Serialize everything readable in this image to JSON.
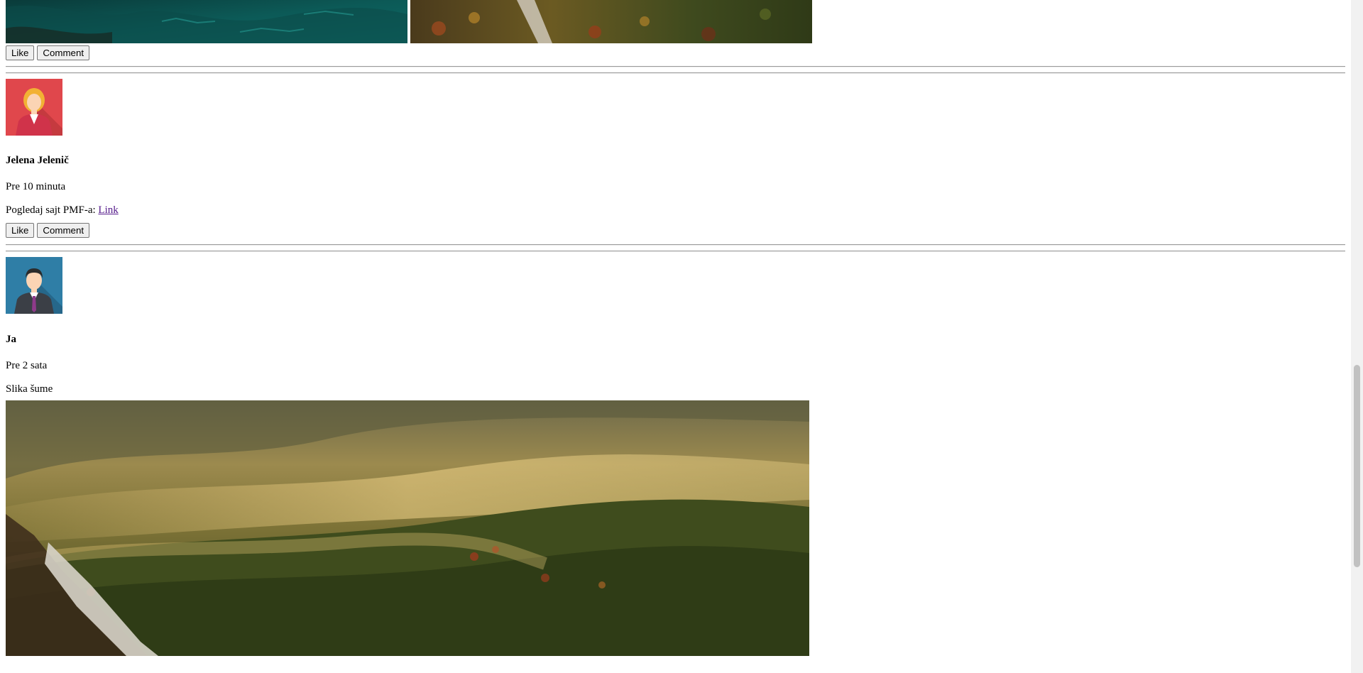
{
  "buttons": {
    "like": "Like",
    "comment": "Comment"
  },
  "posts": [
    {
      "author": "Jelena Jelenič",
      "time": "Pre 10 minuta",
      "text": "Pogledaj sajt PMF-a:",
      "link_text": "Link",
      "avatar_icon": "female-avatar-icon",
      "avatar_color": "#e0474c"
    },
    {
      "author": "Ja",
      "time": "Pre 2 sata",
      "text": "Slika šume",
      "avatar_icon": "male-avatar-icon",
      "avatar_color": "#2f7ea6"
    }
  ],
  "colors": {
    "link_visited": "#551a8b",
    "separator": "#9a9a9a"
  }
}
